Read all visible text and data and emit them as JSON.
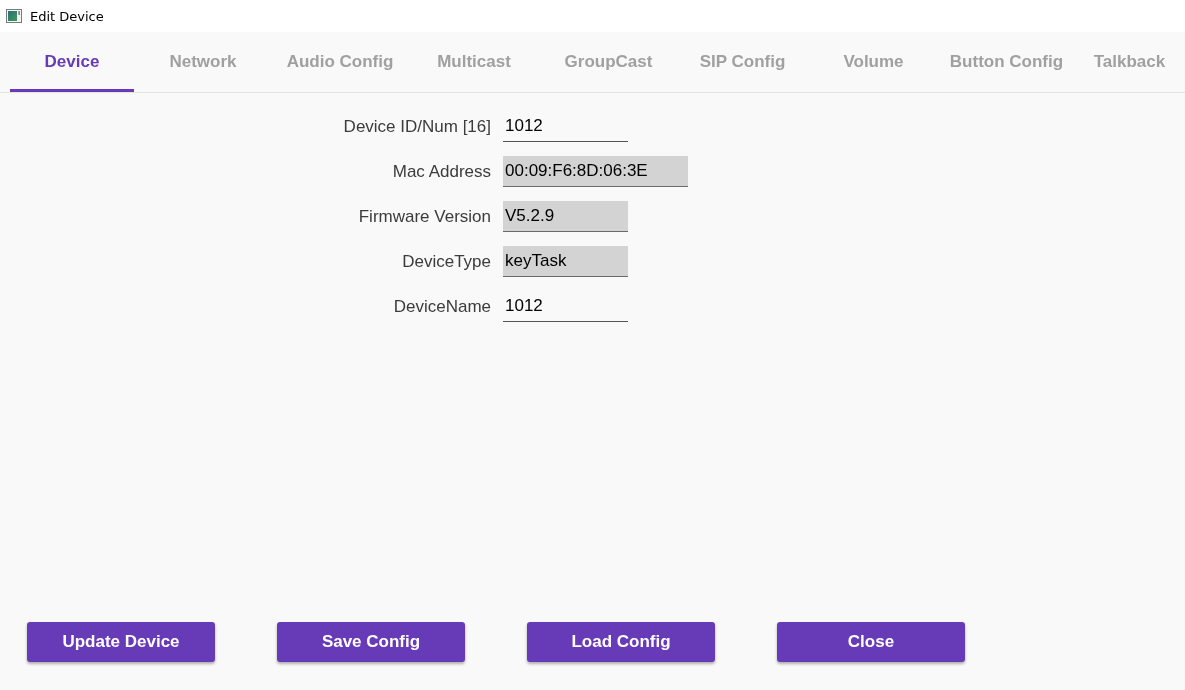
{
  "window": {
    "title": "Edit Device"
  },
  "tabs": [
    {
      "label": "Device",
      "selected": true
    },
    {
      "label": "Network",
      "selected": false
    },
    {
      "label": "Audio Config",
      "selected": false
    },
    {
      "label": "Multicast",
      "selected": false
    },
    {
      "label": "GroupCast",
      "selected": false
    },
    {
      "label": "SIP Config",
      "selected": false
    },
    {
      "label": "Volume",
      "selected": false
    },
    {
      "label": "Button Config",
      "selected": false
    },
    {
      "label": "Talkback",
      "selected": false
    }
  ],
  "fields": [
    {
      "label": "Device ID/Num [16]",
      "value": "1012",
      "readonly": false
    },
    {
      "label": "Mac Address",
      "value": "00:09:F6:8D:06:3E",
      "readonly": true
    },
    {
      "label": "Firmware Version",
      "value": "V5.2.9",
      "readonly": true
    },
    {
      "label": "DeviceType",
      "value": "keyTask",
      "readonly": true
    },
    {
      "label": "DeviceName",
      "value": "1012",
      "readonly": false
    }
  ],
  "buttons": [
    "Update Device",
    "Save Config",
    "Load Config",
    "Close"
  ]
}
